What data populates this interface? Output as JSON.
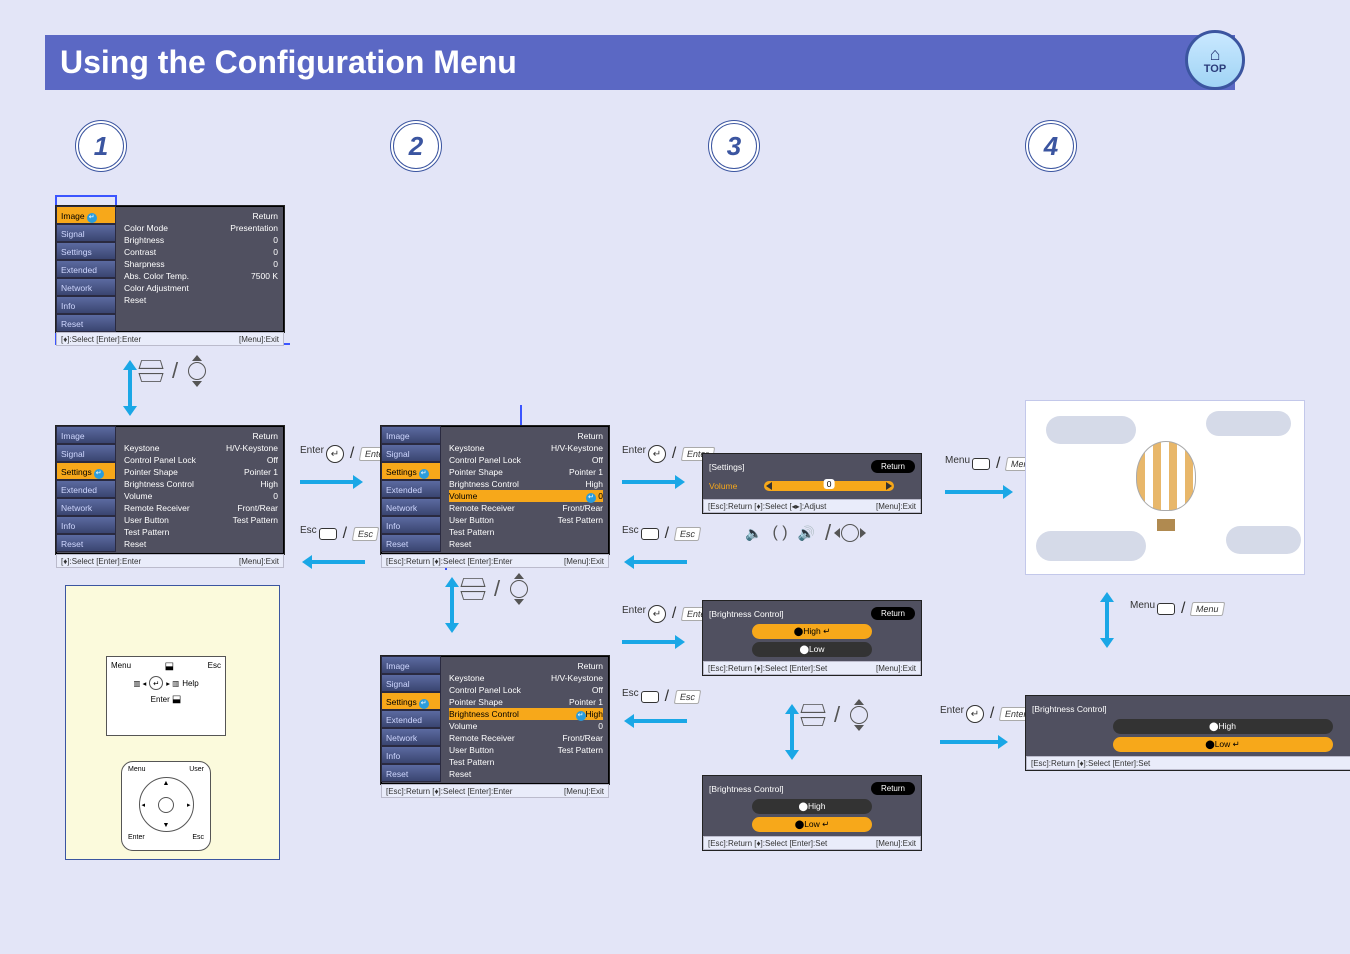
{
  "page": {
    "title": "Using the Configuration Menu",
    "top_badge": "TOP"
  },
  "steps": {
    "one": "1",
    "two": "2",
    "three": "3",
    "four": "4"
  },
  "tabs": {
    "image": "Image",
    "signal": "Signal",
    "settings": "Settings",
    "extended": "Extended",
    "network": "Network",
    "info": "Info",
    "reset": "Reset"
  },
  "common": {
    "return": "Return",
    "menu_exit": "[Menu]:Exit",
    "esc_return": "[Esc]:Return"
  },
  "btn": {
    "enter": "Enter",
    "esc": "Esc",
    "menu": "Menu"
  },
  "osd1": {
    "items": {
      "color_mode": "Color Mode",
      "color_mode_v": "Presentation",
      "brightness": "Brightness",
      "brightness_v": "0",
      "contrast": "Contrast",
      "contrast_v": "0",
      "sharpness": "Sharpness",
      "sharpness_v": "0",
      "abs_temp": "Abs. Color Temp.",
      "abs_temp_v": "7500 K",
      "color_adj": "Color Adjustment",
      "reset": "Reset"
    },
    "helpbar": "[♦]:Select  [Enter]:Enter"
  },
  "osd2": {
    "items": {
      "keystone": "Keystone",
      "keystone_v": "H/V-Keystone",
      "cpl": "Control Panel Lock",
      "cpl_v": "Off",
      "pointer": "Pointer Shape",
      "pointer_v": "Pointer 1",
      "bctrl": "Brightness Control",
      "bctrl_v": "High",
      "volume": "Volume",
      "volume_v": "0",
      "rr": "Remote Receiver",
      "rr_v": "Front/Rear",
      "ub": "User Button",
      "ub_v": "Test Pattern",
      "tp": "Test Pattern",
      "reset": "Reset"
    },
    "helpbar": "[♦]:Select  [Enter]:Enter"
  },
  "osd3": {
    "helpbar": "[Esc]:Return  [♦]:Select  [Enter]:Enter"
  },
  "osd4": {
    "helpbar": "[Esc]:Return  [♦]:Select  [Enter]:Enter"
  },
  "mini_volume": {
    "title": "[Settings]",
    "label": "Volume",
    "value": "0",
    "helpbar": "[Esc]:Return  [♦]:Select  [◂▸]:Adjust"
  },
  "mini_bc": {
    "title": "[Brightness Control]",
    "high": "⬤High",
    "low": "⬤Low",
    "helpbar": "[Esc]:Return  [♦]:Select  [Enter]:Set"
  },
  "remote": {
    "menu": "Menu",
    "esc": "Esc",
    "help": "Help",
    "enter": "Enter",
    "user": "User"
  }
}
